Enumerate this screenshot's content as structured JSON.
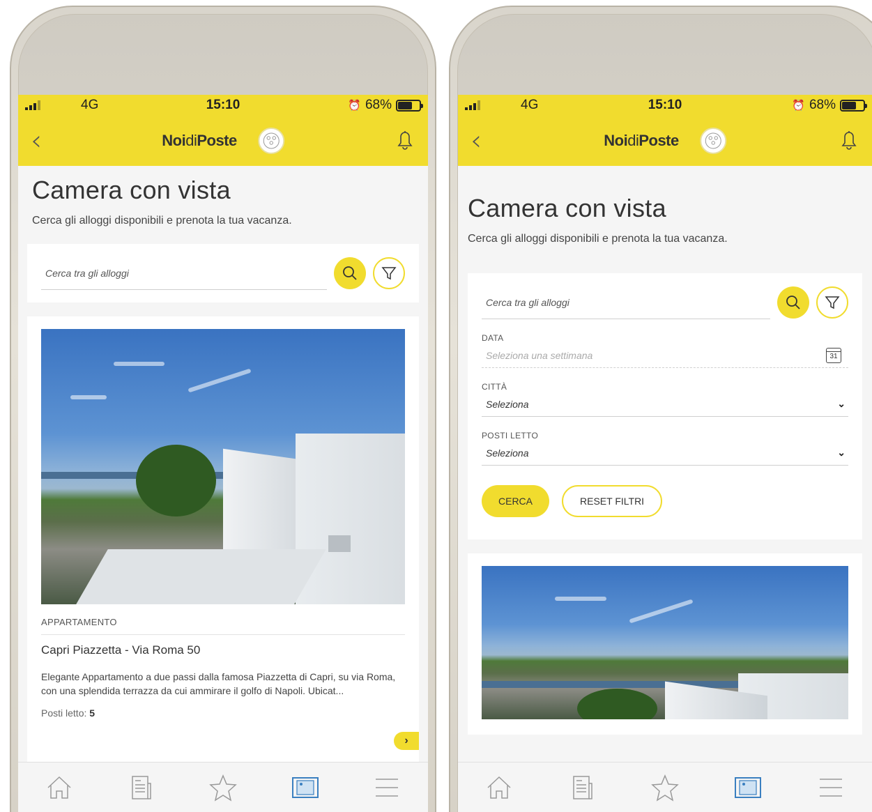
{
  "status": {
    "network": "4G",
    "time": "15:10",
    "battery": "68%",
    "battery_level": 0.68
  },
  "appbar": {
    "brand_noi": "Noi",
    "brand_di": "di",
    "brand_poste": "Poste"
  },
  "page": {
    "title": "Camera con vista",
    "subtitle": "Cerca gli alloggi disponibili e prenota la tua vacanza."
  },
  "search": {
    "placeholder": "Cerca tra gli alloggi"
  },
  "listing": {
    "type": "APPARTAMENTO",
    "title": "Capri Piazzetta - Via Roma 50",
    "description": "Elegante Appartamento a due passi dalla famosa Piazzetta di Capri, su via Roma, con una splendida terrazza da cui ammirare il golfo di Napoli. Ubicat...",
    "beds_label": "Posti letto:",
    "beds_value": "5"
  },
  "filters": {
    "date_label": "DATA",
    "date_placeholder": "Seleziona una settimana",
    "calendar_day": "31",
    "city_label": "CITTÀ",
    "city_value": "Seleziona",
    "beds_label": "POSTI LETTO",
    "beds_value": "Seleziona",
    "search_button": "CERCA",
    "reset_button": "RESET FILTRI"
  },
  "colors": {
    "accent": "#f1dc2e",
    "background": "#f5f5f5"
  },
  "tabs": [
    {
      "icon": "home-icon"
    },
    {
      "icon": "news-icon"
    },
    {
      "icon": "star-icon"
    },
    {
      "icon": "accommodation-icon"
    },
    {
      "icon": "menu-icon"
    }
  ]
}
